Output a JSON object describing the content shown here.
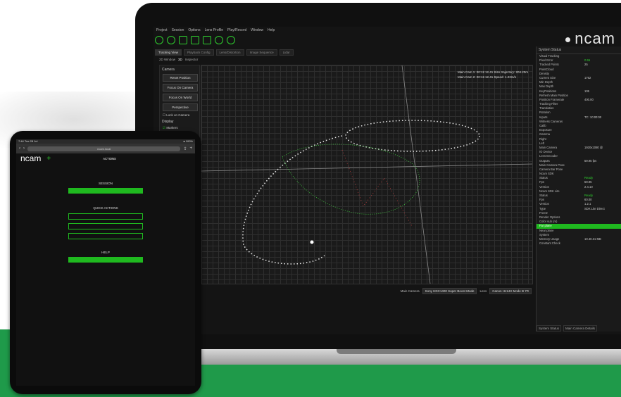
{
  "laptop": {
    "menu": [
      "Project",
      "Session",
      "Options",
      "Lens Profile",
      "Play/Record",
      "Window",
      "Help"
    ],
    "logo": "ncam",
    "tabs": [
      "Tracking View",
      "Playback Config",
      "Lens/Distortion",
      "Image Sequence",
      "Lidar"
    ],
    "view_modes": [
      "2D Window",
      "3D",
      "Inspector"
    ],
    "camera_panel": {
      "title": "Camera",
      "buttons": [
        "Reset Position",
        "Focus On Camera",
        "Focus On World"
      ],
      "projection": "Perspective",
      "lock_label": "Lock on Camera",
      "display_title": "Display",
      "markers_label": "Markers"
    },
    "viewport_info": [
      "Main Cam 1: 00:11:12.41   Size trajectory: 204.20m",
      "Main Cam 2: 00:11:12.41   Speed: 1.23m/s"
    ],
    "status": {
      "main_camera_label": "Main Camera",
      "main_camera_value": "Sony HDC1400 Super Boost Mode",
      "lens_label": "Lens",
      "lens_value": "Canon HJ14X Mode B 7R"
    },
    "system_status": {
      "title": "System Status",
      "rows": [
        {
          "k": "Visual Tracking",
          "v": "",
          "c": ""
        },
        {
          "k": "  Pixel Error",
          "v": "0.55",
          "c": "green"
        },
        {
          "k": "  Tracked Points",
          "v": "25",
          "c": ""
        },
        {
          "k": "  PointCloud",
          "v": "",
          "c": ""
        },
        {
          "k": "    Density",
          "v": "",
          "c": ""
        },
        {
          "k": "    Current Size",
          "v": "1762",
          "c": ""
        },
        {
          "k": "    Min Depth",
          "v": "",
          "c": ""
        },
        {
          "k": "    Max Depth",
          "v": "",
          "c": ""
        },
        {
          "k": "    KeyPositions",
          "v": "105",
          "c": ""
        },
        {
          "k": "  Refresh Main Position",
          "v": "",
          "c": ""
        },
        {
          "k": "  Position Framerate",
          "v": "400.00",
          "c": ""
        },
        {
          "k": "Tracking Filter",
          "v": "",
          "c": ""
        },
        {
          "k": "  Translation",
          "v": "",
          "c": ""
        },
        {
          "k": "  Rotation",
          "v": "",
          "c": ""
        },
        {
          "k": "Inputs",
          "v": "TC: 10:00:00",
          "c": ""
        },
        {
          "k": "  Witness Cameras",
          "v": "",
          "c": ""
        },
        {
          "k": "    Calib",
          "v": "",
          "c": ""
        },
        {
          "k": "    Exposure",
          "v": "",
          "c": ""
        },
        {
          "k": "    Gamma",
          "v": "",
          "c": ""
        },
        {
          "k": "    Right",
          "v": "",
          "c": ""
        },
        {
          "k": "    Left",
          "v": "",
          "c": ""
        },
        {
          "k": "  Main Camera",
          "v": "1920x1080 @",
          "c": ""
        },
        {
          "k": "  IO Device",
          "v": "",
          "c": ""
        },
        {
          "k": "  Lens Encoder",
          "v": "",
          "c": ""
        },
        {
          "k": "Outputs",
          "v": "59.95 fps",
          "c": ""
        },
        {
          "k": "  Main Camera Pose",
          "v": "",
          "c": ""
        },
        {
          "k": "  Camera Bar Pose",
          "v": "",
          "c": ""
        },
        {
          "k": "    Ncam SDK",
          "v": "",
          "c": ""
        },
        {
          "k": "    Status",
          "v": "Ready",
          "c": "green"
        },
        {
          "k": "    Fps",
          "v": "59.95",
          "c": ""
        },
        {
          "k": "    Version",
          "v": "2.4.10",
          "c": ""
        },
        {
          "k": "    Ncam SDK Lite",
          "v": "",
          "c": ""
        },
        {
          "k": "    Status",
          "v": "Ready",
          "c": "green"
        },
        {
          "k": "    Fps",
          "v": "60.00",
          "c": ""
        },
        {
          "k": "    Version",
          "v": "1.2.1",
          "c": ""
        },
        {
          "k": "    Type",
          "v": "SDK Lite Direct",
          "c": ""
        },
        {
          "k": "  FreeD",
          "v": "",
          "c": ""
        },
        {
          "k": "  Render Options",
          "v": "",
          "c": ""
        },
        {
          "k": "    Color sub (m)",
          "v": "",
          "c": ""
        },
        {
          "k": "    Far plane",
          "v": "",
          "c": "hl"
        },
        {
          "k": "    Near plane",
          "v": "",
          "c": ""
        },
        {
          "k": "System",
          "v": "",
          "c": ""
        },
        {
          "k": "  Memory Usage",
          "v": "10.40.31 MB",
          "c": ""
        },
        {
          "k": "  Constant Check",
          "v": "",
          "c": ""
        }
      ],
      "bottom_tabs": [
        "System Status",
        "Main Camera Details"
      ]
    }
  },
  "tablet": {
    "status_time": "7:44  Tue 28 Jul",
    "status_right": "● 100%",
    "url": "ncam.local",
    "logo": "ncam",
    "plus": "+",
    "nav": [
      "",
      "",
      "",
      "ACTIONS"
    ],
    "section1_title": "SESSION",
    "section1_button": "",
    "section2_title": "QUICK ACTIONS",
    "quick_actions": [
      "",
      "",
      ""
    ],
    "section3_title": "HELP",
    "section3_button": ""
  },
  "colors": {
    "accent": "#1fb91f",
    "band": "#1f9a4a",
    "background": "#141414"
  }
}
